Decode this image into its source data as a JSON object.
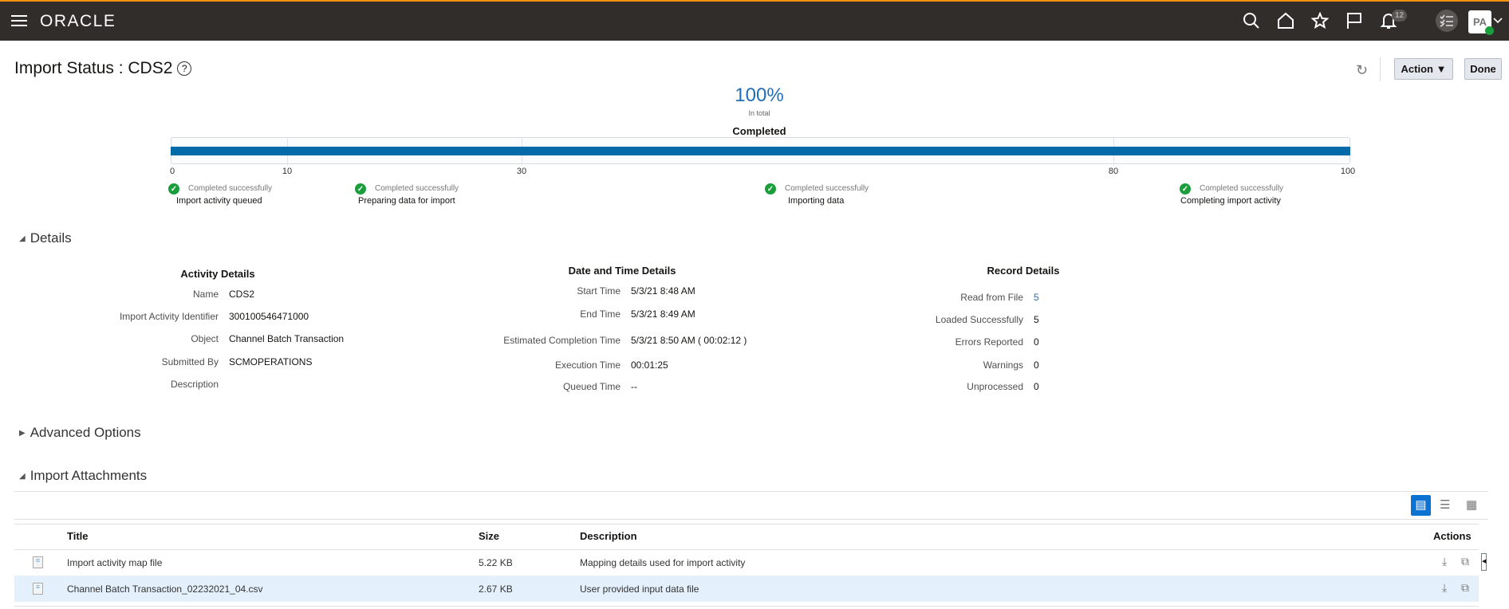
{
  "header": {
    "brand": "ORACLE",
    "notification_count": "12",
    "avatar_initials": "PA"
  },
  "page": {
    "title": "Import Status : CDS2",
    "action_label": "Action",
    "done_label": "Done"
  },
  "progress": {
    "percent_label": "100%",
    "percent": 100,
    "subtitle": "In total",
    "status": "Completed",
    "ticks": [
      "0",
      "10",
      "30",
      "80",
      "100"
    ],
    "steps": [
      {
        "status": "Completed successfully",
        "name": "Import activity queued"
      },
      {
        "status": "Completed successfully",
        "name": "Preparing data for import"
      },
      {
        "status": "Completed successfully",
        "name": "Importing data"
      },
      {
        "status": "Completed successfully",
        "name": "Completing import activity"
      }
    ]
  },
  "details": {
    "section": "Details",
    "activity": {
      "heading": "Activity Details",
      "rows": [
        {
          "label": "Name",
          "value": "CDS2"
        },
        {
          "label": "Import Activity Identifier",
          "value": "300100546471000"
        },
        {
          "label": "Object",
          "value": "Channel Batch Transaction"
        },
        {
          "label": "Submitted By",
          "value": "SCMOPERATIONS"
        },
        {
          "label": "Description",
          "value": ""
        }
      ]
    },
    "datetime": {
      "heading": "Date and Time Details",
      "rows": [
        {
          "label": "Start Time",
          "value": "5/3/21 8:48 AM"
        },
        {
          "label": "End Time",
          "value": "5/3/21 8:49 AM"
        },
        {
          "label": "Estimated Completion Time",
          "value": "5/3/21 8:50 AM ( 00:02:12 )"
        },
        {
          "label": "Execution Time",
          "value": "00:01:25"
        },
        {
          "label": "Queued Time",
          "value": "--"
        }
      ]
    },
    "records": {
      "heading": "Record Details",
      "rows": [
        {
          "label": "Read from File",
          "value": "5"
        },
        {
          "label": "Loaded Successfully",
          "value": "5"
        },
        {
          "label": "Errors Reported",
          "value": "0"
        },
        {
          "label": "Warnings",
          "value": "0"
        },
        {
          "label": "Unprocessed",
          "value": "0"
        }
      ]
    }
  },
  "advanced": {
    "section": "Advanced Options"
  },
  "attachments": {
    "section": "Import Attachments",
    "columns": {
      "title": "Title",
      "size": "Size",
      "description": "Description",
      "actions": "Actions"
    },
    "rows": [
      {
        "title": "Import activity map file",
        "size": "5.22 KB",
        "description": "Mapping details used for import activity"
      },
      {
        "title": "Channel Batch Transaction_02232021_04.csv",
        "size": "2.67 KB",
        "description": "User provided input data file"
      }
    ]
  },
  "colors": {
    "accent": "#046aa8",
    "success": "#1a9e3b",
    "header_bg": "#312d2a",
    "selected_row": "#e4f0fc"
  }
}
